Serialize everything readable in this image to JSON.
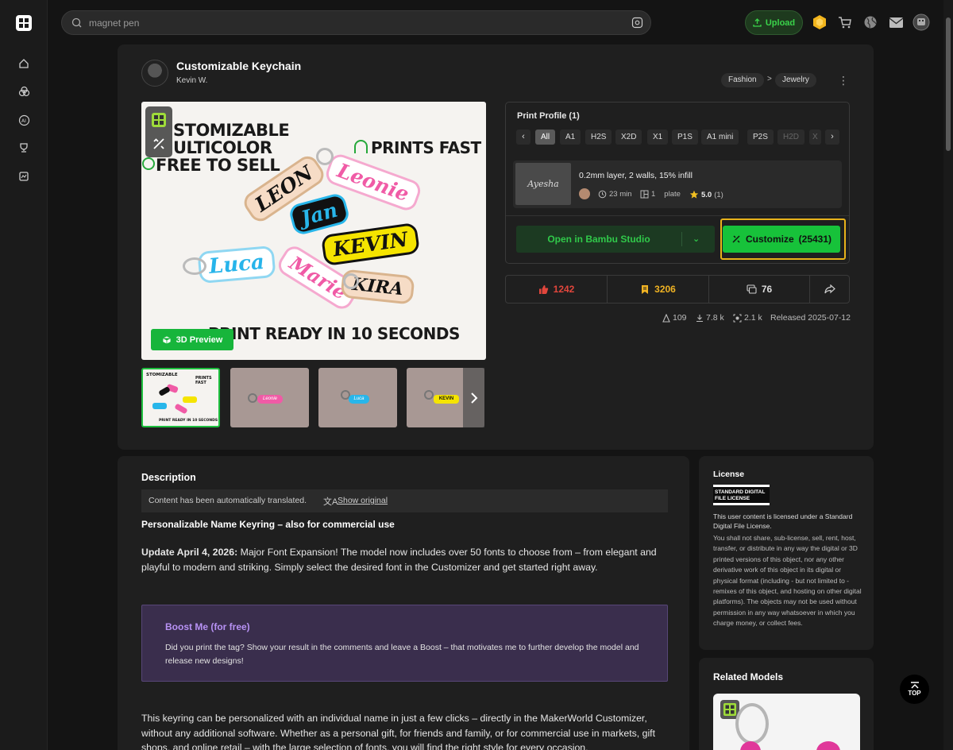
{
  "search": {
    "value": "magnet pen"
  },
  "topbar": {
    "upload_label": "Upload"
  },
  "model": {
    "title": "Customizable Keychain",
    "author": "Kevin W.",
    "categories": [
      "Fashion",
      "Jewelry"
    ],
    "category_separator": ">"
  },
  "hero": {
    "line1": "STOMIZABLE",
    "line2": "ULTICOLOR",
    "line3": "FREE TO SELL",
    "prints_fast": "PRINTS FAST",
    "bottom": "PRINT READY IN 10 SECONDS",
    "names": [
      "LEON",
      "Leonie",
      "Jan",
      "KEVIN",
      "Luca",
      "Marie",
      "KIRA"
    ],
    "preview_label": "3D Preview"
  },
  "thumbs": {
    "names": [
      "Leonie",
      "Luca",
      "KEVIN"
    ]
  },
  "profile": {
    "title": "Print Profile (1)",
    "printers": [
      "All",
      "A1",
      "H2S",
      "X2D",
      "X1",
      "P1S",
      "A1 mini",
      "P2S",
      "H2D",
      "X"
    ],
    "thumb_text": "Ayesha",
    "name": "0.2mm layer, 2 walls, 15% infill",
    "time": "23 min",
    "plates": "1",
    "plate_label": "plate",
    "rating": "5.0",
    "rating_count": "(1)",
    "open_label": "Open in Bambu Studio",
    "customize_label": "Customize",
    "customize_count": "(25431)"
  },
  "stats": {
    "likes": "1242",
    "collects": "3206",
    "comments": "76",
    "prints": "109",
    "downloads": "7.8 k",
    "views": "2.1 k",
    "released": "Released 2025-07-12"
  },
  "description": {
    "heading": "Description",
    "translated_note": "Content has been automatically translated.",
    "show_original": "Show original",
    "subtitle": "Personalizable Name Keyring – also for commercial use",
    "update_bold": "Update April 4, 2026:",
    "update_text": " Major Font Expansion! The model now includes over 50 fonts to choose from – from elegant and playful to modern and striking. Simply select the desired font in the Customizer and get started right away.",
    "boost_title": "Boost Me (for free)",
    "boost_text": "Did you print the tag? Show your result in the comments and leave a Boost – that motivates me to further develop the model and release new designs!",
    "body": "This keyring can be personalized with an individual name in just a few clicks – directly in the MakerWorld Customizer, without any additional software. Whether as a personal gift, for friends and family, or for commercial use in markets, gift shops, and online retail – with the large selection of fonts, you will find the right style for every occasion."
  },
  "license": {
    "heading": "License",
    "badge": "STANDARD DIGITAL FILE LICENSE",
    "intro": "This user content is licensed under a Standard Digital File License.",
    "text": "You shall not share, sub-license, sell, rent, host, transfer, or distribute in any way the digital or 3D printed versions of this object, nor any other derivative work of this object in its digital or physical format (including - but not limited to - remixes of this object, and hosting on other digital platforms). The objects may not be used without permission in any way whatsoever in which you charge money, or collect fees."
  },
  "related": {
    "heading": "Related Models"
  },
  "scroll_top_label": "TOP",
  "colors": {
    "accent_green": "#17c23a",
    "highlight_yellow": "#e8b21a",
    "like_red": "#e2463c",
    "collect_yellow": "#f0b323",
    "boost_purple": "#b892f5"
  }
}
